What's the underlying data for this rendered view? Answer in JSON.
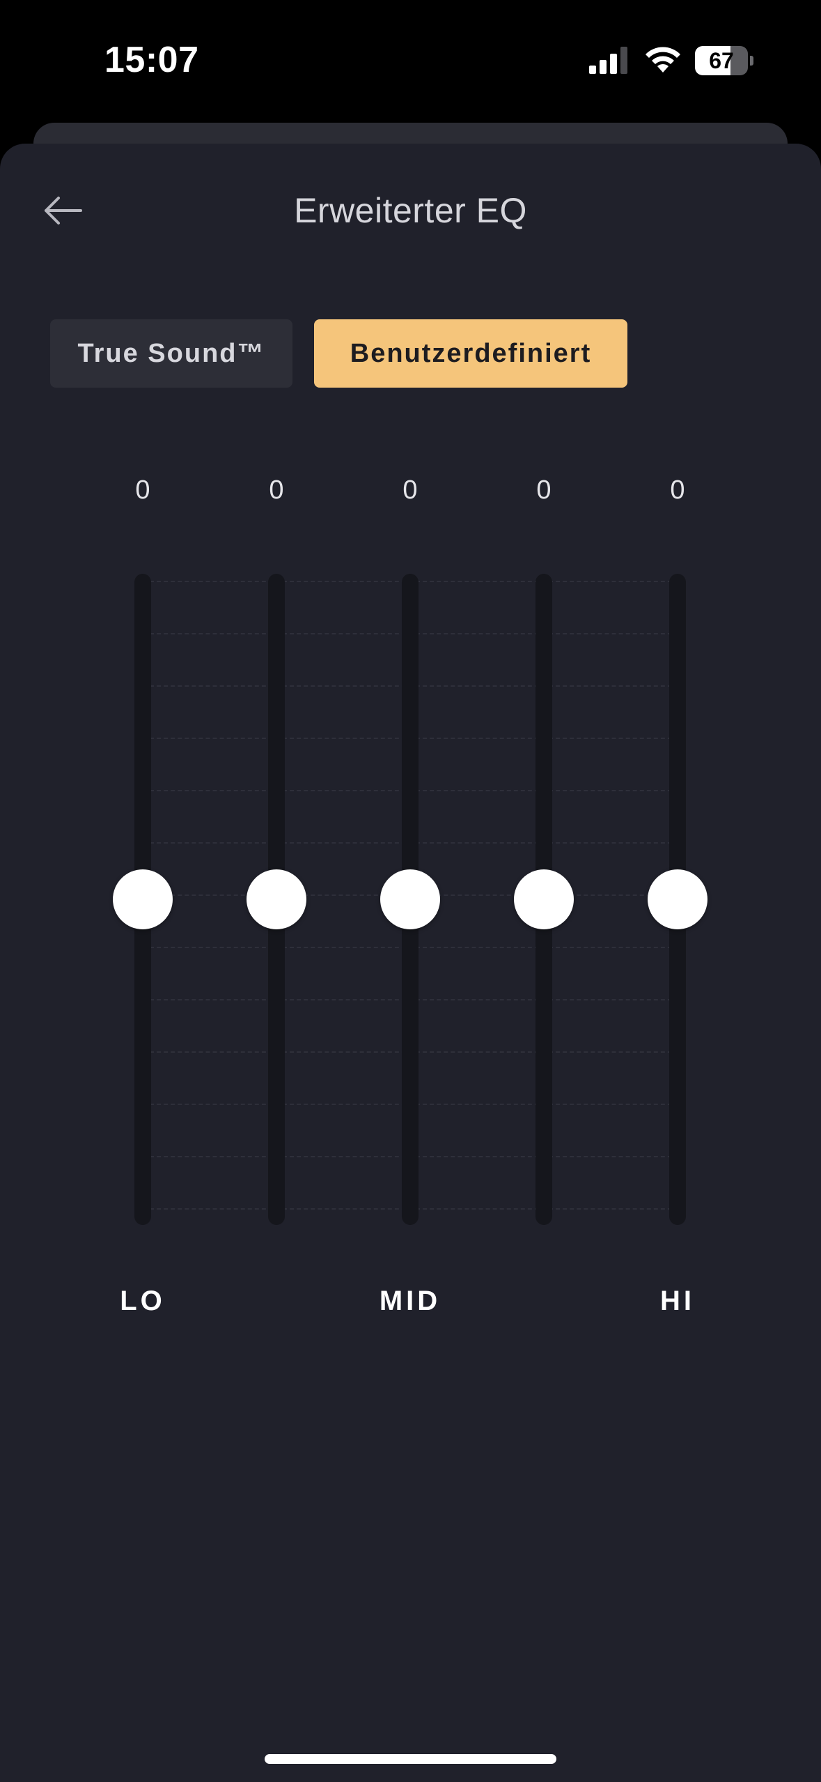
{
  "status_bar": {
    "time": "15:07",
    "battery_level": "67",
    "battery_fraction": 0.67,
    "signal_bars_active": 3,
    "signal_icon": "cellular-signal-icon",
    "wifi_icon": "wifi-icon"
  },
  "header": {
    "title": "Erweiterter EQ",
    "back_icon": "arrow-left-icon"
  },
  "presets": [
    {
      "label": "True Sound™",
      "selected": false
    },
    {
      "label": "Benutzerdefiniert",
      "selected": true
    }
  ],
  "colors": {
    "background": "#20212b",
    "accent": "#f5c57b",
    "preset_inactive": "#2d2e37",
    "track": "#15161c",
    "thumb": "#ffffff"
  },
  "eq": {
    "min": -6,
    "max": 6,
    "bands": [
      {
        "value": 0,
        "display": "0"
      },
      {
        "value": 0,
        "display": "0"
      },
      {
        "value": 0,
        "display": "0"
      },
      {
        "value": 0,
        "display": "0"
      },
      {
        "value": 0,
        "display": "0"
      }
    ],
    "labels": [
      "LO",
      "MID",
      "HI"
    ]
  }
}
